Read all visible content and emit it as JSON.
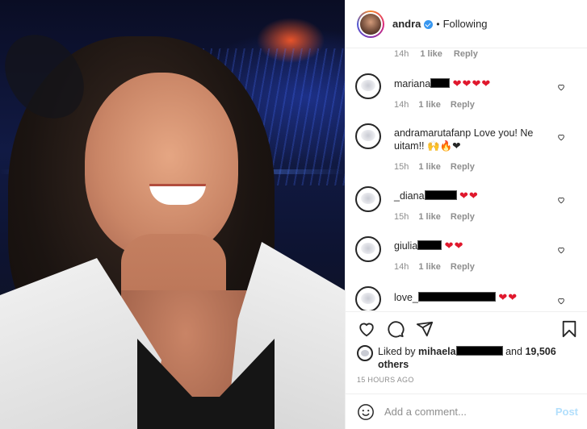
{
  "header": {
    "username": "andra",
    "separator": "•",
    "follow_state": "Following"
  },
  "comments": {
    "top_meta": {
      "time": "14h",
      "likes": "1 like",
      "reply": "Reply"
    },
    "items": [
      {
        "username": "mariana",
        "text": "",
        "hearts": "❤❤❤❤",
        "time": "14h",
        "likes": "1 like",
        "reply": "Reply"
      },
      {
        "username": "andramarutafanp",
        "text": "Love you! Ne uitam!!",
        "emojis": "🙌🔥❤",
        "time": "15h",
        "likes": "1 like",
        "reply": "Reply"
      },
      {
        "username": "_diana",
        "text": "",
        "hearts": "❤❤",
        "time": "15h",
        "likes": "1 like",
        "reply": "Reply"
      },
      {
        "username": "giulia",
        "text": "",
        "hearts": "❤❤",
        "time": "14h",
        "likes": "1 like",
        "reply": "Reply"
      },
      {
        "username": "love_",
        "text": "",
        "hearts": "❤❤",
        "time": "",
        "likes": "",
        "reply": ""
      }
    ]
  },
  "likes": {
    "prefix": "Liked by",
    "user": "mihaela",
    "and": "and",
    "others": "19,506 others"
  },
  "timestamp": "15 HOURS AGO",
  "add_comment": {
    "placeholder": "Add a comment...",
    "post_label": "Post"
  },
  "colors": {
    "text": "#262626",
    "muted": "#8e8e8e",
    "heart": "#e0182d",
    "verified": "#3897f0",
    "post_disabled": "#b2dffc"
  },
  "icons": [
    "heart-icon",
    "comment-icon",
    "share-icon",
    "bookmark-icon",
    "emoji-icon",
    "verified-badge-icon"
  ]
}
